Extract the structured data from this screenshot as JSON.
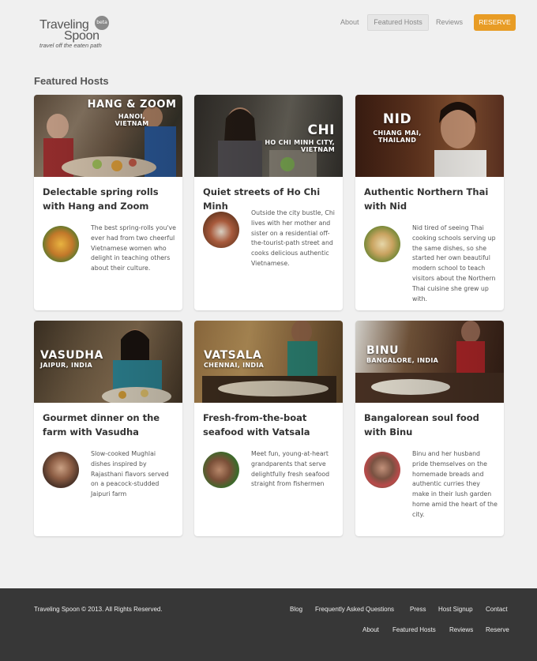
{
  "header": {
    "logo_line1": "Traveling",
    "logo_line2": "Spoon",
    "logo_badge": "beta",
    "tagline": "travel off the eaten path",
    "nav": {
      "about": "About",
      "featured_hosts": "Featured Hosts",
      "reviews": "Reviews",
      "reserve": "RESERVE"
    }
  },
  "main": {
    "section_title": "Featured Hosts",
    "hosts": [
      {
        "place_name": "HANG & ZOOM",
        "place_location": "HANOI, VIETNAM",
        "title": "Delectable spring rolls with Hang and Zoom",
        "description": "The best spring-rolls you've ever had from two cheerful Vietnamese women who delight in teaching others about their culture."
      },
      {
        "place_name": "CHI",
        "place_location": "HO CHI MINH CITY, VIETNAM",
        "title": "Quiet streets of Ho Chi Minh",
        "description": "Outside the city bustle, Chi lives with her mother and sister on a residential off-the-tourist-path street and cooks delicious authentic Vietnamese."
      },
      {
        "place_name": "NID",
        "place_location": "CHIANG MAI, THAILAND",
        "title": "Authentic Northern Thai with Nid",
        "description": "Nid tired of seeing Thai cooking schools serving up the same dishes, so she started her own beautiful modern school to teach visitors about the Northern Thai cuisine she grew up with."
      },
      {
        "place_name": "VASUDHA",
        "place_location": "JAIPUR, INDIA",
        "title": "Gourmet dinner on the farm with Vasudha",
        "description": "Slow-cooked Mughlai dishes inspired by Rajasthani flavors served on a peacock-studded Jaipuri farm"
      },
      {
        "place_name": "VATSALA",
        "place_location": "CHENNAI, INDIA",
        "title": "Fresh-from-the-boat seafood with Vatsala",
        "description": "Meet fun, young-at-heart grandparents that serve delightfully fresh seafood straight from fishermen"
      },
      {
        "place_name": "BINU",
        "place_location": "BANGALORE, INDIA",
        "title": "Bangalorean soul food with Binu",
        "description": "Binu and her husband pride themselves on the homemade breads and authentic curries they make in their lush garden home amid the heart of the city."
      }
    ]
  },
  "footer": {
    "copyright": "Traveling Spoon © 2013. All Rights Reserved.",
    "links_row1": [
      "Blog",
      "Frequently Asked Questions",
      "Press",
      "Host Signup",
      "Contact"
    ],
    "links_row2": [
      "About",
      "Featured Hosts",
      "Reviews",
      "Reserve"
    ]
  },
  "colors": {
    "accent": "#e89c25",
    "background": "#f0f0f0",
    "footer": "#373737"
  }
}
